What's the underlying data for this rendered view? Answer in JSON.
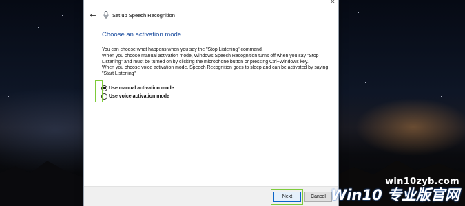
{
  "window": {
    "close_glyph": "×",
    "back_glyph": "←",
    "title": "Set up Speech Recognition"
  },
  "page": {
    "heading": "Choose an activation mode",
    "paragraph1": "You can choose what happens when you say the \"Stop Listening\" command.",
    "paragraph2": "When you choose manual activation mode, Windows Speech Recognition turns off when you say \"Stop Listening\" and must be turned on by clicking the microphone button or pressing Ctrl+Windows key.",
    "paragraph3": "When you choose voice activation mode, Speech Recognition goes to sleep and can be activated by saying \"Start Listening\""
  },
  "options": {
    "selected": "manual",
    "manual_label": "Use manual activation mode",
    "voice_label": "Use voice activation mode"
  },
  "footer": {
    "next_label": "Next",
    "cancel_label": "Cancel"
  },
  "watermark": {
    "url": "win10zyb.com",
    "logo": "Win10 专业版官网"
  },
  "colors": {
    "heading": "#1e4fa0",
    "highlight_box": "#7ecb3a"
  }
}
